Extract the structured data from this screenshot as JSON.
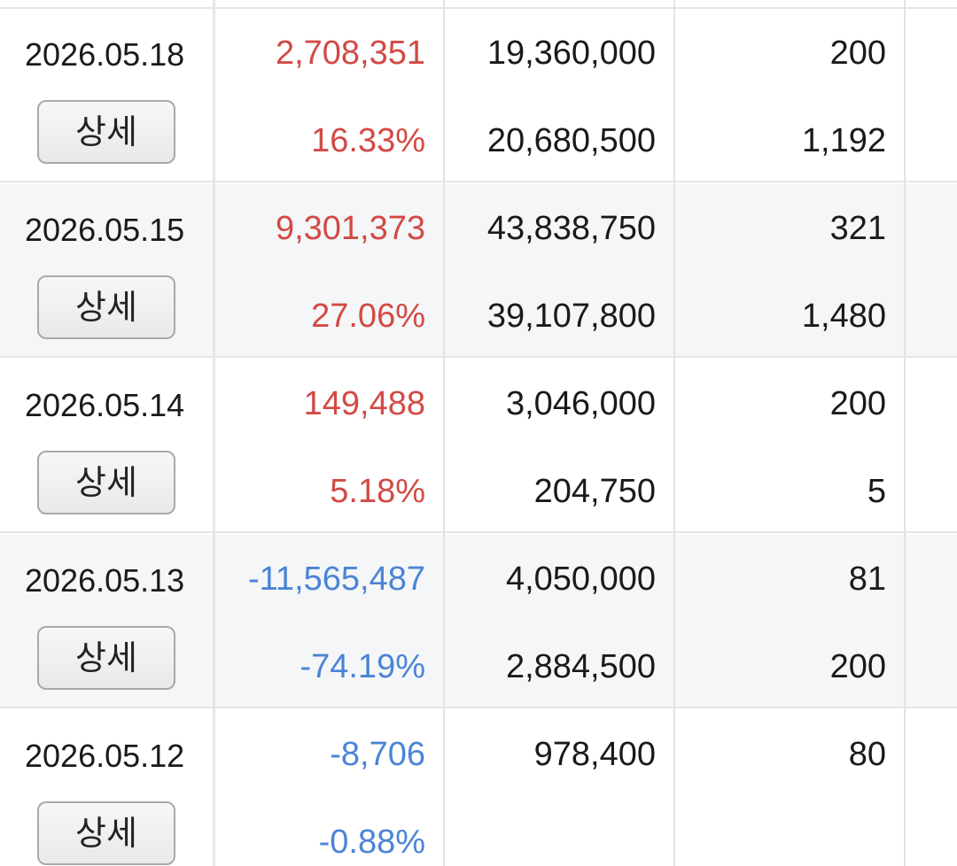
{
  "colors": {
    "positive": "#d24a44",
    "negative": "#4a84d6"
  },
  "rows": [
    {
      "date": "2026.05.18",
      "button": "상세",
      "profit": "2,708,351",
      "rate": "16.33%",
      "amount1": "19,360,000",
      "amount2": "20,680,500",
      "qty1": "200",
      "qty2": "1,192",
      "sign": "positive"
    },
    {
      "date": "2026.05.15",
      "button": "상세",
      "profit": "9,301,373",
      "rate": "27.06%",
      "amount1": "43,838,750",
      "amount2": "39,107,800",
      "qty1": "321",
      "qty2": "1,480",
      "sign": "positive"
    },
    {
      "date": "2026.05.14",
      "button": "상세",
      "profit": "149,488",
      "rate": "5.18%",
      "amount1": "3,046,000",
      "amount2": "204,750",
      "qty1": "200",
      "qty2": "5",
      "sign": "positive"
    },
    {
      "date": "2026.05.13",
      "button": "상세",
      "profit": "-11,565,487",
      "rate": "-74.19%",
      "amount1": "4,050,000",
      "amount2": "2,884,500",
      "qty1": "81",
      "qty2": "200",
      "sign": "negative"
    },
    {
      "date": "2026.05.12",
      "button": "상세",
      "profit": "-8,706",
      "rate": "-0.88%",
      "amount1": "978,400",
      "amount2": "",
      "qty1": "80",
      "qty2": "",
      "sign": "negative"
    }
  ]
}
